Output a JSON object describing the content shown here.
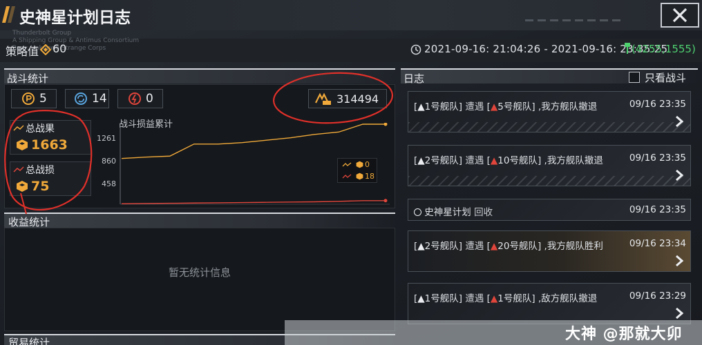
{
  "header": {
    "title": "史神星计划日志",
    "close_icon": "close-icon"
  },
  "strategy": {
    "label": "策略值",
    "value": "60",
    "icon": "diamond-gold-icon"
  },
  "watermark_small": [
    "Thunderbolt Group",
    "A Shipping Group & Antimus Consortium",
    "Rear: Unknown Strange Corps"
  ],
  "time_range": "2021-09-16: 21:04:26 - 2021-09-16: 23:35:25",
  "coordinates": "(4255,1555)",
  "battle_stats": {
    "section_title": "战斗统计",
    "counters": [
      {
        "icon": "coin-p-icon",
        "value": "5"
      },
      {
        "icon": "cycle-icon",
        "value": "14"
      },
      {
        "icon": "destroy-icon",
        "value": "0"
      }
    ],
    "exp": {
      "icon": "exp-icon",
      "value": "314494"
    },
    "total_gain": {
      "label": "总战果",
      "value": "1663"
    },
    "total_loss": {
      "label": "总战损",
      "value": "75"
    },
    "chart_title": "战斗损益累计",
    "legend": [
      {
        "value": "0"
      },
      {
        "value": "18"
      }
    ]
  },
  "chart_data": {
    "type": "line",
    "title": "战斗损益累计",
    "xlabel": "",
    "ylabel": "",
    "yticks": [
      "1261",
      "860",
      "458"
    ],
    "ylim": [
      0,
      1663
    ],
    "series": [
      {
        "color": "#f0a93a",
        "values": [
          950,
          980,
          1000,
          1250,
          1250,
          1280,
          1330,
          1380,
          1450,
          1500,
          1663,
          1663
        ]
      },
      {
        "color": "#e0453b",
        "values": [
          10,
          15,
          20,
          25,
          30,
          35,
          40,
          45,
          50,
          60,
          75,
          75
        ]
      }
    ],
    "colors": {
      "gain": "#f0a93a",
      "loss": "#e0453b"
    }
  },
  "income": {
    "section_title": "收益统计",
    "empty_message": "暂无统计信息"
  },
  "trade": {
    "section_title": "贸易统计"
  },
  "log": {
    "section_title": "日志",
    "filter_label": "只看战斗",
    "entries": [
      {
        "ally": "1号舰队",
        "verb": "遭遇",
        "enemy": "5号舰队",
        "result": ",我方舰队撤退",
        "time": "09/16 23:35",
        "kind": "tall"
      },
      {
        "ally": "2号舰队",
        "verb": "遭遇",
        "enemy": "10号舰队",
        "result": ",我方舰队撤退",
        "time": "09/16 23:35",
        "kind": "tall"
      },
      {
        "ally": "史神星计划",
        "verb": "回收",
        "enemy": "",
        "result": "",
        "time": "09/16 23:35",
        "kind": "short"
      },
      {
        "ally": "2号舰队",
        "verb": "遭遇",
        "enemy": "20号舰队",
        "result": ",我方舰队胜利",
        "time": "09/16 23:34",
        "kind": "win"
      },
      {
        "ally": "1号舰队",
        "verb": "遭遇",
        "enemy": "1号舰队",
        "result": ",敌方舰队撤退",
        "time": "09/16 23:29",
        "kind": "tall"
      }
    ]
  },
  "watermark": "大神 @那就大卯"
}
